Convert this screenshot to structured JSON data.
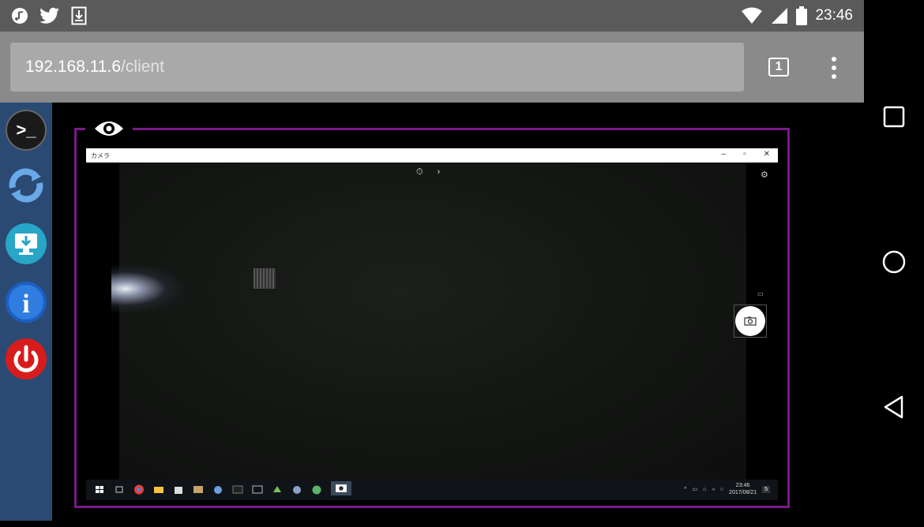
{
  "status_bar": {
    "icons_left": [
      "music-app-icon",
      "twitter-icon",
      "download-icon"
    ],
    "icons_right": [
      "wifi-icon",
      "signal-icon",
      "battery-icon"
    ],
    "time": "23:46"
  },
  "browser": {
    "url_host": "192.168.11.6",
    "url_path": "/client",
    "tab_count": "1",
    "menu_icon": "overflow-menu-icon"
  },
  "sidebar": {
    "items": [
      {
        "name": "terminal",
        "icon": "terminal-icon",
        "label": ">_"
      },
      {
        "name": "refresh",
        "icon": "refresh-icon"
      },
      {
        "name": "download-screen",
        "icon": "monitor-download-icon"
      },
      {
        "name": "info",
        "icon": "info-icon",
        "label": "i"
      },
      {
        "name": "power",
        "icon": "power-icon"
      }
    ]
  },
  "viewer": {
    "eye_icon": "eye-icon",
    "remote_window": {
      "title": "カメラ",
      "controls": [
        "–",
        "▫",
        "✕"
      ],
      "top_controls": [
        "⏱",
        "›"
      ]
    },
    "taskbar": {
      "clock_time": "23:46",
      "clock_date": "2017/08/21",
      "notification_count": "5"
    }
  },
  "nav": {
    "recents": "recents-square-icon",
    "home": "home-circle-icon",
    "back": "back-triangle-icon"
  },
  "colors": {
    "frame_border": "#7a1a8a",
    "sidebar_bg": "#2b4a73",
    "power_red": "#d81c1c",
    "info_blue": "#1b5fc2",
    "download_teal": "#27a6c8"
  }
}
